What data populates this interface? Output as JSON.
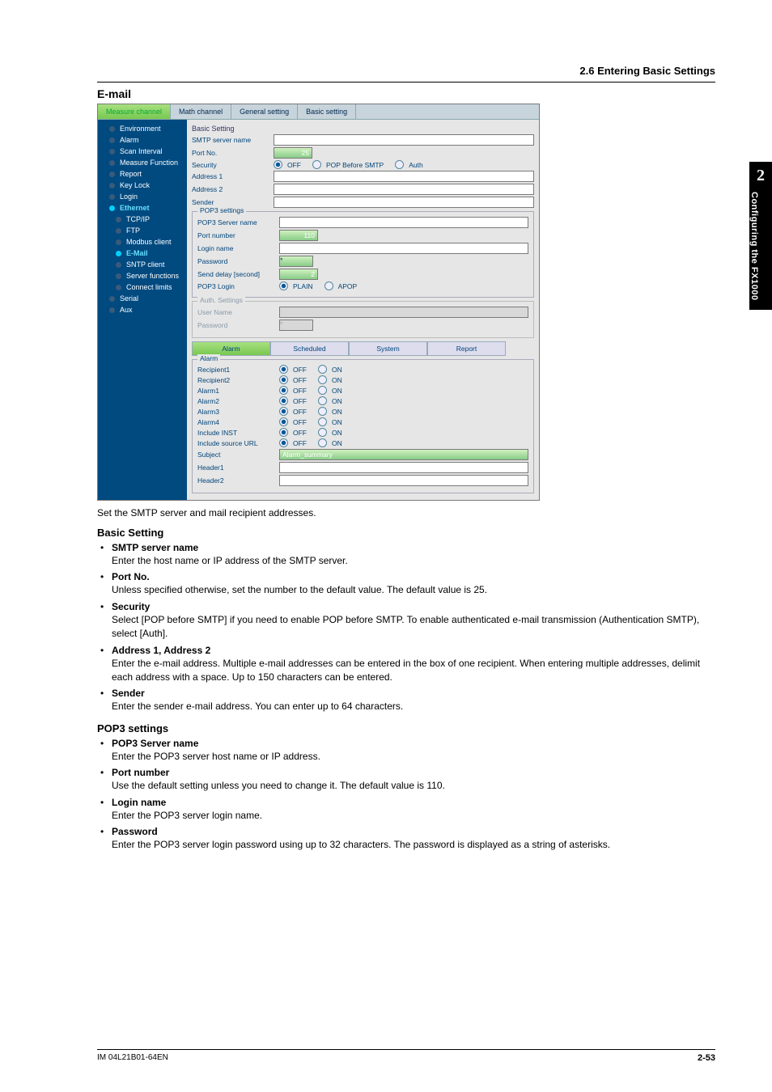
{
  "header": {
    "section": "2.6  Entering Basic Settings"
  },
  "thumb": {
    "chapter": "2",
    "title": "Configuring the FX1000"
  },
  "heading": "E-mail",
  "screenshot": {
    "tabs": [
      "Measure channel",
      "Math channel",
      "General setting",
      "Basic setting"
    ],
    "sidebar": {
      "items": [
        {
          "label": "Environment"
        },
        {
          "label": "Alarm"
        },
        {
          "label": "Scan Interval"
        },
        {
          "label": "Measure Function"
        },
        {
          "label": "Report"
        },
        {
          "label": "Key Lock"
        },
        {
          "label": "Login"
        },
        {
          "label": "Ethernet",
          "selected": true
        },
        {
          "label": "TCP/IP",
          "sub": true
        },
        {
          "label": "FTP",
          "sub": true
        },
        {
          "label": "Modbus client",
          "sub": true
        },
        {
          "label": "E-Mail",
          "sub": true,
          "selected": true
        },
        {
          "label": "SNTP client",
          "sub": true
        },
        {
          "label": "Server functions",
          "sub": true
        },
        {
          "label": "Connect limits",
          "sub": true
        },
        {
          "label": "Serial"
        },
        {
          "label": "Aux"
        }
      ]
    },
    "basic": {
      "title": "Basic Setting",
      "smtp_label": "SMTP server name",
      "port_label": "Port No.",
      "port_value": "25",
      "security_label": "Security",
      "security_opts": [
        "OFF",
        "POP Before SMTP",
        "Auth"
      ],
      "addr1_label": "Address 1",
      "addr2_label": "Address 2",
      "sender_label": "Sender"
    },
    "pop3_fs": {
      "legend": "POP3 settings",
      "server_label": "POP3 Server name",
      "port_label": "Port number",
      "port_value": "110",
      "login_label": "Login name",
      "pw_label": "Password",
      "pw_value": "*",
      "delay_label": "Send delay [second]",
      "delay_value": "2",
      "pop3login_label": "POP3 Login",
      "pop3login_opts": [
        "PLAIN",
        "APOP"
      ]
    },
    "auth_fs": {
      "legend": "Auth. Settings",
      "user_label": "User Name",
      "pw_label": "Password",
      "pw_value": "*"
    },
    "tabbtns": [
      "Alarm",
      "Scheduled",
      "System",
      "Report"
    ],
    "alarm_fs": {
      "legend": "Alarm",
      "rows": [
        "Recipient1",
        "Recipient2",
        "Alarm1",
        "Alarm2",
        "Alarm3",
        "Alarm4",
        "Include INST",
        "Include source URL"
      ],
      "opts": [
        "OFF",
        "ON"
      ],
      "subject_label": "Subject",
      "subject_value": "Alarm_summary",
      "header1_label": "Header1",
      "header2_label": "Header2"
    }
  },
  "caption": "Set the SMTP server and mail recipient addresses.",
  "sections": [
    {
      "title": "Basic Setting",
      "items": [
        {
          "head": "SMTP server name",
          "body": "Enter the host name or IP address of the SMTP server."
        },
        {
          "head": "Port No.",
          "body": "Unless specified otherwise, set the number to the default value.  The default value is 25."
        },
        {
          "head": "Security",
          "body": "Select [POP before SMTP] if you need to enable POP before SMTP.  To enable authenticated e-mail transmission (Authentication SMTP), select [Auth]."
        },
        {
          "head": "Address 1, Address 2",
          "body": "Enter the e-mail address.  Multiple e-mail addresses can be entered in the box of one recipient.  When entering multiple addresses, delimit each address with a space.  Up to 150 characters can be entered."
        },
        {
          "head": "Sender",
          "body": "Enter the sender e-mail address.  You can enter up to 64 characters."
        }
      ]
    },
    {
      "title": "POP3 settings",
      "items": [
        {
          "head": "POP3 Server name",
          "body": "Enter the POP3 server host name or IP address."
        },
        {
          "head": "Port number",
          "body": "Use the default setting unless you need to change it. The default value is 110."
        },
        {
          "head": "Login name",
          "body": "Enter the POP3 server login name."
        },
        {
          "head": "Password",
          "body": "Enter the POP3 server login password using up to 32 characters. The password is displayed as a string of asterisks."
        }
      ]
    }
  ],
  "footer": {
    "left": "IM 04L21B01-64EN",
    "right": "2-53"
  }
}
